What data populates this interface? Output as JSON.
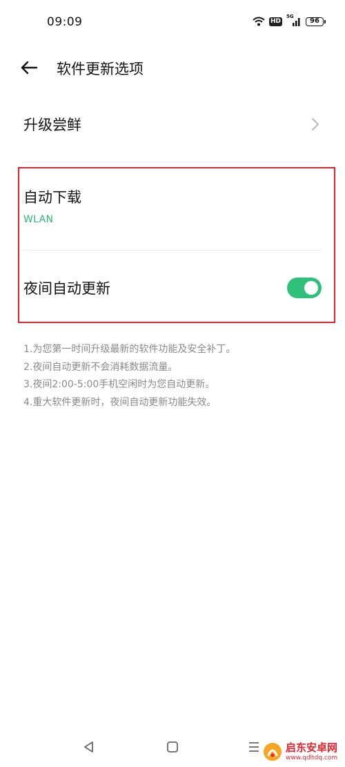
{
  "status_bar": {
    "time": "09:09",
    "icons": [
      "wifi-icon",
      "hd-badge",
      "signal-5g-icon",
      "battery-icon"
    ],
    "hd_label": "HD",
    "network_label": "5G",
    "battery": "96"
  },
  "header": {
    "back_icon": "arrow-left-icon",
    "title": "软件更新选项"
  },
  "settings": {
    "upgrade_label": "升级尝鲜",
    "auto_download_label": "自动下载",
    "auto_download_value": "WLAN",
    "night_update_label": "夜间自动更新",
    "night_update_on": true
  },
  "notes": [
    "1.为您第一时间升级最新的软件功能及安全补丁。",
    "2.夜间自动更新不会消耗数据流量。",
    "3.夜间2:00-5:00手机空闲时为您自动更新。",
    "4.重大软件更新时，夜间自动更新功能失效。"
  ],
  "nav": {
    "icons": [
      "back-triangle-icon",
      "home-square-icon",
      "menu-lines-icon"
    ]
  },
  "watermark": {
    "name": "启东安卓网",
    "url": "www.qdltdq.com"
  },
  "colors": {
    "accent": "#2fc07a",
    "subtitle_green": "#2bb673",
    "highlight_red": "#d9262c",
    "note_gray": "#8a8a8a"
  }
}
